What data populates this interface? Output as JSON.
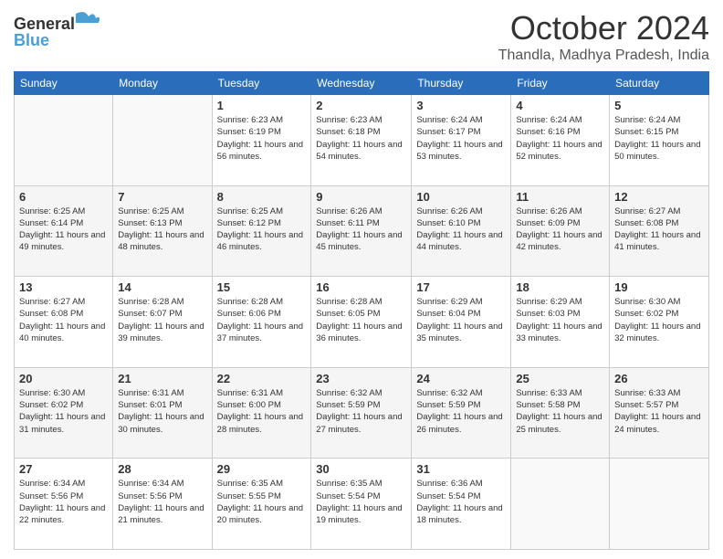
{
  "header": {
    "logo_general": "General",
    "logo_blue": "Blue",
    "month_title": "October 2024",
    "location": "Thandla, Madhya Pradesh, India"
  },
  "weekdays": [
    "Sunday",
    "Monday",
    "Tuesday",
    "Wednesday",
    "Thursday",
    "Friday",
    "Saturday"
  ],
  "weeks": [
    [
      {
        "day": "",
        "sunrise": "",
        "sunset": "",
        "daylight": ""
      },
      {
        "day": "",
        "sunrise": "",
        "sunset": "",
        "daylight": ""
      },
      {
        "day": "1",
        "sunrise": "Sunrise: 6:23 AM",
        "sunset": "Sunset: 6:19 PM",
        "daylight": "Daylight: 11 hours and 56 minutes."
      },
      {
        "day": "2",
        "sunrise": "Sunrise: 6:23 AM",
        "sunset": "Sunset: 6:18 PM",
        "daylight": "Daylight: 11 hours and 54 minutes."
      },
      {
        "day": "3",
        "sunrise": "Sunrise: 6:24 AM",
        "sunset": "Sunset: 6:17 PM",
        "daylight": "Daylight: 11 hours and 53 minutes."
      },
      {
        "day": "4",
        "sunrise": "Sunrise: 6:24 AM",
        "sunset": "Sunset: 6:16 PM",
        "daylight": "Daylight: 11 hours and 52 minutes."
      },
      {
        "day": "5",
        "sunrise": "Sunrise: 6:24 AM",
        "sunset": "Sunset: 6:15 PM",
        "daylight": "Daylight: 11 hours and 50 minutes."
      }
    ],
    [
      {
        "day": "6",
        "sunrise": "Sunrise: 6:25 AM",
        "sunset": "Sunset: 6:14 PM",
        "daylight": "Daylight: 11 hours and 49 minutes."
      },
      {
        "day": "7",
        "sunrise": "Sunrise: 6:25 AM",
        "sunset": "Sunset: 6:13 PM",
        "daylight": "Daylight: 11 hours and 48 minutes."
      },
      {
        "day": "8",
        "sunrise": "Sunrise: 6:25 AM",
        "sunset": "Sunset: 6:12 PM",
        "daylight": "Daylight: 11 hours and 46 minutes."
      },
      {
        "day": "9",
        "sunrise": "Sunrise: 6:26 AM",
        "sunset": "Sunset: 6:11 PM",
        "daylight": "Daylight: 11 hours and 45 minutes."
      },
      {
        "day": "10",
        "sunrise": "Sunrise: 6:26 AM",
        "sunset": "Sunset: 6:10 PM",
        "daylight": "Daylight: 11 hours and 44 minutes."
      },
      {
        "day": "11",
        "sunrise": "Sunrise: 6:26 AM",
        "sunset": "Sunset: 6:09 PM",
        "daylight": "Daylight: 11 hours and 42 minutes."
      },
      {
        "day": "12",
        "sunrise": "Sunrise: 6:27 AM",
        "sunset": "Sunset: 6:08 PM",
        "daylight": "Daylight: 11 hours and 41 minutes."
      }
    ],
    [
      {
        "day": "13",
        "sunrise": "Sunrise: 6:27 AM",
        "sunset": "Sunset: 6:08 PM",
        "daylight": "Daylight: 11 hours and 40 minutes."
      },
      {
        "day": "14",
        "sunrise": "Sunrise: 6:28 AM",
        "sunset": "Sunset: 6:07 PM",
        "daylight": "Daylight: 11 hours and 39 minutes."
      },
      {
        "day": "15",
        "sunrise": "Sunrise: 6:28 AM",
        "sunset": "Sunset: 6:06 PM",
        "daylight": "Daylight: 11 hours and 37 minutes."
      },
      {
        "day": "16",
        "sunrise": "Sunrise: 6:28 AM",
        "sunset": "Sunset: 6:05 PM",
        "daylight": "Daylight: 11 hours and 36 minutes."
      },
      {
        "day": "17",
        "sunrise": "Sunrise: 6:29 AM",
        "sunset": "Sunset: 6:04 PM",
        "daylight": "Daylight: 11 hours and 35 minutes."
      },
      {
        "day": "18",
        "sunrise": "Sunrise: 6:29 AM",
        "sunset": "Sunset: 6:03 PM",
        "daylight": "Daylight: 11 hours and 33 minutes."
      },
      {
        "day": "19",
        "sunrise": "Sunrise: 6:30 AM",
        "sunset": "Sunset: 6:02 PM",
        "daylight": "Daylight: 11 hours and 32 minutes."
      }
    ],
    [
      {
        "day": "20",
        "sunrise": "Sunrise: 6:30 AM",
        "sunset": "Sunset: 6:02 PM",
        "daylight": "Daylight: 11 hours and 31 minutes."
      },
      {
        "day": "21",
        "sunrise": "Sunrise: 6:31 AM",
        "sunset": "Sunset: 6:01 PM",
        "daylight": "Daylight: 11 hours and 30 minutes."
      },
      {
        "day": "22",
        "sunrise": "Sunrise: 6:31 AM",
        "sunset": "Sunset: 6:00 PM",
        "daylight": "Daylight: 11 hours and 28 minutes."
      },
      {
        "day": "23",
        "sunrise": "Sunrise: 6:32 AM",
        "sunset": "Sunset: 5:59 PM",
        "daylight": "Daylight: 11 hours and 27 minutes."
      },
      {
        "day": "24",
        "sunrise": "Sunrise: 6:32 AM",
        "sunset": "Sunset: 5:59 PM",
        "daylight": "Daylight: 11 hours and 26 minutes."
      },
      {
        "day": "25",
        "sunrise": "Sunrise: 6:33 AM",
        "sunset": "Sunset: 5:58 PM",
        "daylight": "Daylight: 11 hours and 25 minutes."
      },
      {
        "day": "26",
        "sunrise": "Sunrise: 6:33 AM",
        "sunset": "Sunset: 5:57 PM",
        "daylight": "Daylight: 11 hours and 24 minutes."
      }
    ],
    [
      {
        "day": "27",
        "sunrise": "Sunrise: 6:34 AM",
        "sunset": "Sunset: 5:56 PM",
        "daylight": "Daylight: 11 hours and 22 minutes."
      },
      {
        "day": "28",
        "sunrise": "Sunrise: 6:34 AM",
        "sunset": "Sunset: 5:56 PM",
        "daylight": "Daylight: 11 hours and 21 minutes."
      },
      {
        "day": "29",
        "sunrise": "Sunrise: 6:35 AM",
        "sunset": "Sunset: 5:55 PM",
        "daylight": "Daylight: 11 hours and 20 minutes."
      },
      {
        "day": "30",
        "sunrise": "Sunrise: 6:35 AM",
        "sunset": "Sunset: 5:54 PM",
        "daylight": "Daylight: 11 hours and 19 minutes."
      },
      {
        "day": "31",
        "sunrise": "Sunrise: 6:36 AM",
        "sunset": "Sunset: 5:54 PM",
        "daylight": "Daylight: 11 hours and 18 minutes."
      },
      {
        "day": "",
        "sunrise": "",
        "sunset": "",
        "daylight": ""
      },
      {
        "day": "",
        "sunrise": "",
        "sunset": "",
        "daylight": ""
      }
    ]
  ]
}
